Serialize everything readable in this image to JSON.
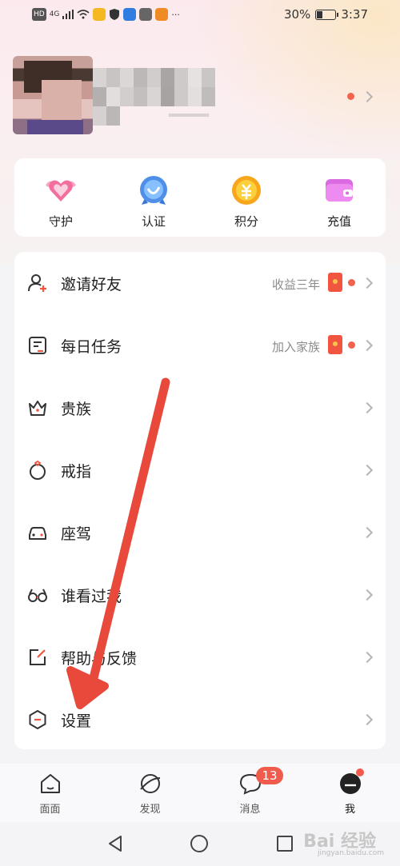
{
  "status_bar": {
    "hd": "HD",
    "network": "4G",
    "battery": "30%",
    "battery_level": 0.3,
    "time": "3:37",
    "more": "···"
  },
  "profile": {
    "has_notification_dot": true
  },
  "quick_actions": [
    {
      "label": "守护",
      "icon": "heart-badge-icon"
    },
    {
      "label": "认证",
      "icon": "verified-badge-icon"
    },
    {
      "label": "积分",
      "icon": "points-coin-icon"
    },
    {
      "label": "充值",
      "icon": "wallet-icon"
    }
  ],
  "menu": [
    {
      "label": "邀请好友",
      "icon": "invite-friend-icon",
      "extra": "收益三年",
      "red_packet": true,
      "dot": true
    },
    {
      "label": "每日任务",
      "icon": "daily-task-icon",
      "extra": "加入家族",
      "red_packet": true,
      "dot": true
    },
    {
      "label": "贵族",
      "icon": "crown-icon",
      "extra": "",
      "red_packet": false,
      "dot": false
    },
    {
      "label": "戒指",
      "icon": "ring-icon",
      "extra": "",
      "red_packet": false,
      "dot": false
    },
    {
      "label": "座驾",
      "icon": "car-icon",
      "extra": "",
      "red_packet": false,
      "dot": false
    },
    {
      "label": "谁看过我",
      "icon": "glasses-icon",
      "extra": "",
      "red_packet": false,
      "dot": false
    },
    {
      "label": "帮助与反馈",
      "icon": "feedback-icon",
      "extra": "",
      "red_packet": false,
      "dot": false
    },
    {
      "label": "设置",
      "icon": "settings-icon",
      "extra": "",
      "red_packet": false,
      "dot": false
    }
  ],
  "tab_bar": {
    "tabs": [
      {
        "label": "面面",
        "icon": "home-icon"
      },
      {
        "label": "发现",
        "icon": "planet-icon"
      },
      {
        "label": "消息",
        "icon": "message-icon",
        "badge": "13"
      },
      {
        "label": "我",
        "icon": "me-avatar-icon",
        "active": true
      }
    ]
  },
  "watermark": {
    "text": "Bai 经验",
    "sub": "jingyan.baidu.com"
  },
  "colors": {
    "accent_red": "#f05b4b",
    "arrow_red": "#e8493b"
  }
}
